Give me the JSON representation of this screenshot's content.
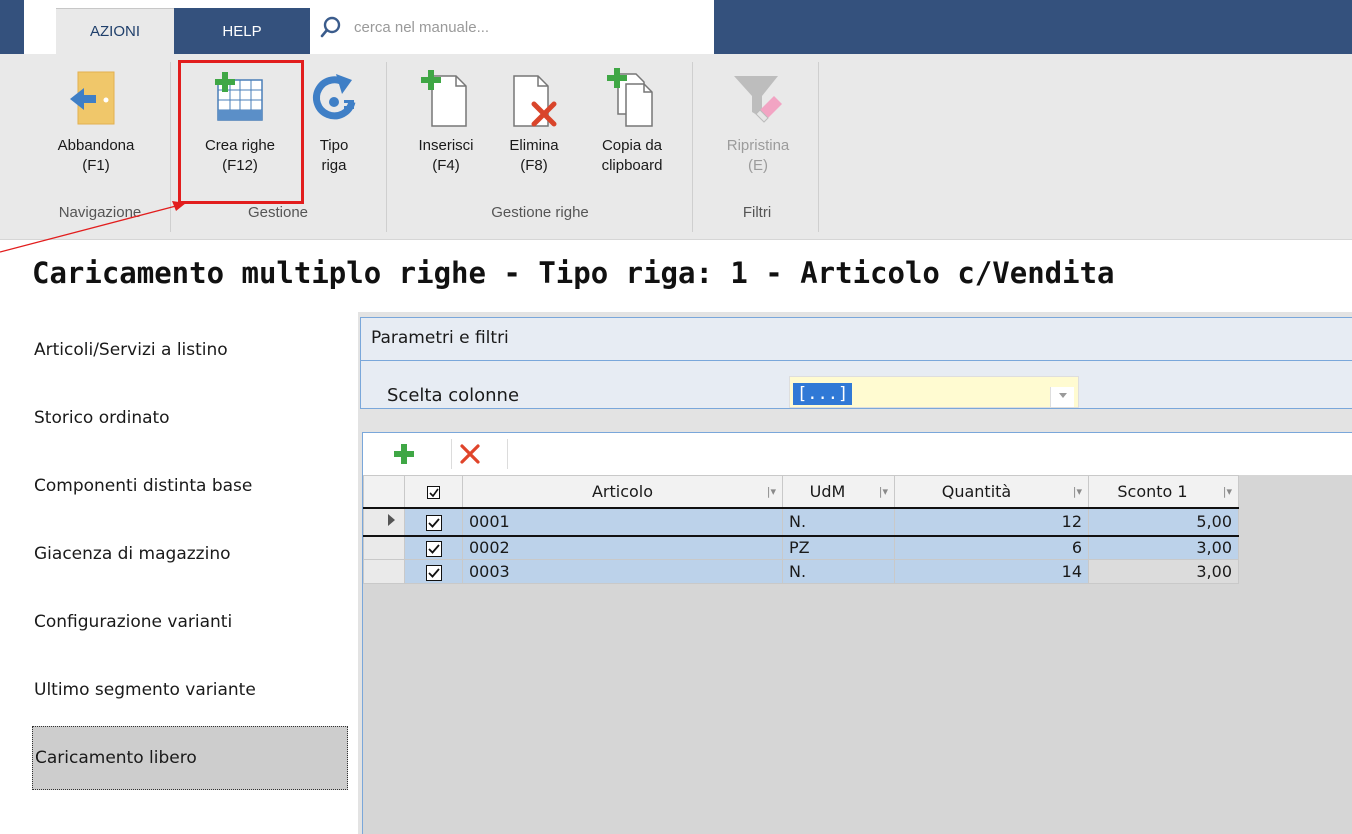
{
  "tabs": {
    "azioni": "AZIONI",
    "help": "HELP"
  },
  "search": {
    "placeholder": "cerca nel manuale..."
  },
  "ribbon": {
    "abbandona": {
      "line1": "Abbandona",
      "line2": "(F1)"
    },
    "crea_righe": {
      "line1": "Crea righe",
      "line2": "(F12)"
    },
    "tipo_riga": {
      "line1": "Tipo",
      "line2": "riga"
    },
    "inserisci": {
      "line1": "Inserisci",
      "line2": "(F4)"
    },
    "elimina": {
      "line1": "Elimina",
      "line2": "(F8)"
    },
    "copia": {
      "line1": "Copia da",
      "line2": "clipboard"
    },
    "ripristina": {
      "line1": "Ripristina",
      "line2": "(E)"
    },
    "groups": {
      "navigazione": "Navigazione",
      "gestione": "Gestione",
      "gestione_righe": "Gestione righe",
      "filtri": "Filtri"
    }
  },
  "page_title": "Caricamento multiplo righe - Tipo riga: 1 - Articolo c/Vendita",
  "sidebar": {
    "items": [
      {
        "label": "Articoli/Servizi a listino"
      },
      {
        "label": "Storico ordinato"
      },
      {
        "label": "Componenti distinta base"
      },
      {
        "label": "Giacenza di magazzino"
      },
      {
        "label": "Configurazione varianti"
      },
      {
        "label": "Ultimo segmento variante"
      },
      {
        "label": "Caricamento libero"
      }
    ],
    "active_index": 6
  },
  "params": {
    "title": "Parametri e filtri",
    "scelta_label": "Scelta colonne",
    "scelta_value": "[...]"
  },
  "grid": {
    "columns": [
      "Articolo",
      "UdM",
      "Quantità",
      "Sconto 1"
    ],
    "rows": [
      {
        "checked": true,
        "articolo": "0001",
        "udm": "N.",
        "quantita": "12",
        "sconto": "5,00"
      },
      {
        "checked": true,
        "articolo": "0002",
        "udm": "PZ",
        "quantita": "6",
        "sconto": "3,00"
      },
      {
        "checked": true,
        "articolo": "0003",
        "udm": "N.",
        "quantita": "14",
        "sconto": "3,00"
      }
    ]
  },
  "colors": {
    "brand_blue": "#34517d",
    "highlight_red": "#e21d1d",
    "row_selected": "#bcd2ea"
  }
}
